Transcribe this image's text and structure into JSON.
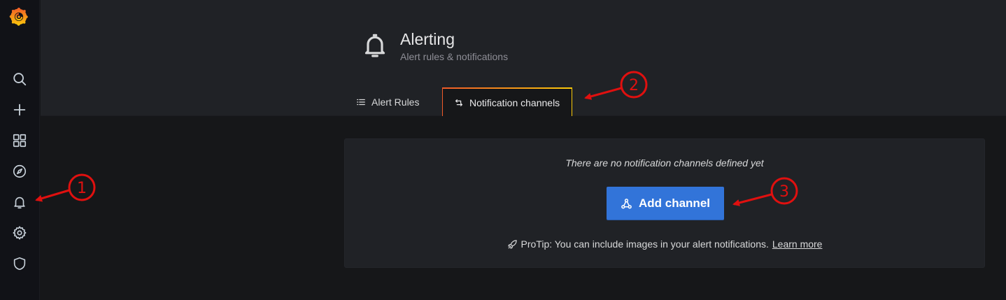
{
  "sidebar": {
    "logo": "grafana-logo-icon",
    "items": [
      {
        "icon": "search-icon"
      },
      {
        "icon": "plus-icon"
      },
      {
        "icon": "dashboards-icon"
      },
      {
        "icon": "explore-compass-icon"
      },
      {
        "icon": "bell-icon"
      },
      {
        "icon": "gear-icon"
      },
      {
        "icon": "shield-icon"
      }
    ]
  },
  "header": {
    "icon": "bell-icon",
    "title": "Alerting",
    "subtitle": "Alert rules & notifications",
    "tabs": [
      {
        "label": "Alert Rules",
        "icon": "list-icon",
        "active": false
      },
      {
        "label": "Notification channels",
        "icon": "channel-icon",
        "active": true
      }
    ]
  },
  "empty_state": {
    "message": "There are no notification channels defined yet",
    "button_label": "Add channel",
    "button_icon": "channel-add-icon",
    "protip_text": "ProTip: You can include images in your alert notifications.",
    "protip_link": "Learn more",
    "protip_icon": "rocket-icon"
  },
  "annotations": [
    {
      "label": "1"
    },
    {
      "label": "2"
    },
    {
      "label": "3"
    }
  ],
  "colors": {
    "background": "#161719",
    "sidebar": "#111217",
    "panel": "#202226",
    "primary_button": "#3274d9",
    "tab_accent_start": "#f05a28",
    "tab_accent_end": "#fbca0a",
    "annotation": "#e0100f"
  }
}
